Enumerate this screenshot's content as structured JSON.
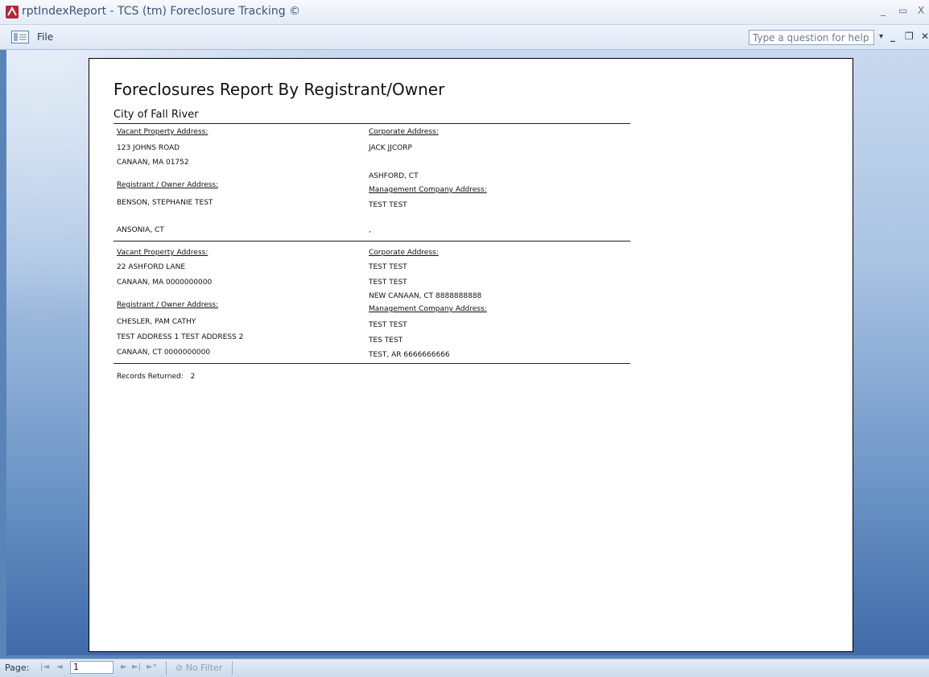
{
  "window": {
    "title": "rptIndexReport - TCS (tm) Foreclosure Tracking ©",
    "minimize": "_",
    "restore": "▭",
    "close": "X"
  },
  "menu": {
    "file": "File",
    "help_placeholder": "Type a question for help",
    "help_dropdown": "▾",
    "mdi_minimize": "_",
    "mdi_restore": "❐",
    "mdi_close": "✕"
  },
  "report": {
    "title": "Foreclosures Report By Registrant/Owner",
    "city": "City of Fall River",
    "records": [
      {
        "vacant_label": "Vacant Property Address:",
        "vacant_line1": "123 JOHNS ROAD",
        "vacant_line2": "CANAAN, MA 01752",
        "registrant_label": "Registrant / Owner Address:",
        "registrant_line1": "BENSON, STEPHANIE TEST",
        "registrant_line2": "ANSONIA, CT",
        "corporate_label": "Corporate Address:",
        "corporate_line1": "JACK JJCORP",
        "corporate_line2": "ASHFORD, CT",
        "management_label": "Management Company Address:",
        "management_line1": "TEST TEST",
        "management_line2": ","
      },
      {
        "vacant_label": "Vacant Property Address:",
        "vacant_line1": "22 ASHFORD LANE",
        "vacant_line2": "CANAAN, MA 0000000000",
        "registrant_label": "Registrant / Owner Address:",
        "registrant_line1": "CHESLER, PAM CATHY",
        "registrant_line2": "TEST ADDRESS 1 TEST ADDRESS 2",
        "registrant_line3": "CANAAN, CT 0000000000",
        "corporate_label": "Corporate Address:",
        "corporate_line1": "TEST TEST",
        "corporate_line2": "TEST TEST",
        "corporate_line3": "NEW CANAAN, CT 8888888888",
        "management_label": "Management Company Address:",
        "management_line1": "TEST TEST",
        "management_line2": "TES TEST",
        "management_line3": "TEST, AR 6666666666"
      }
    ],
    "records_returned_label": "Records Returned:",
    "records_returned": "2"
  },
  "status": {
    "page_label": "Page:",
    "page_value": "1",
    "first": "|◄",
    "prev": "◄",
    "next": "►",
    "last": "►|",
    "new": "►*",
    "no_filter": "No Filter"
  }
}
